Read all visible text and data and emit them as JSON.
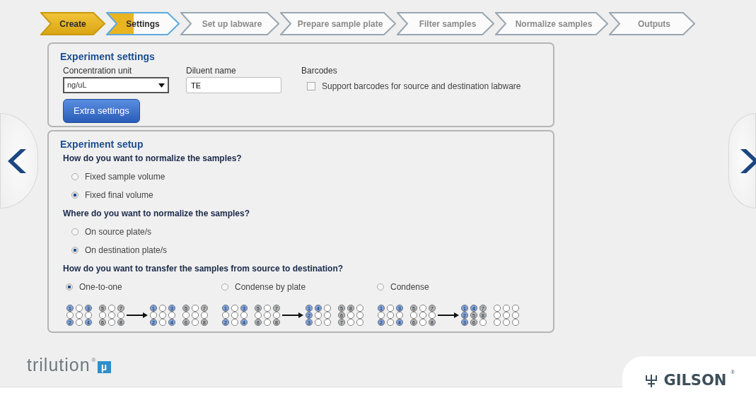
{
  "steps": [
    {
      "label": "Create",
      "completed": true,
      "selected": false
    },
    {
      "label": "Settings",
      "completed": false,
      "selected": true
    },
    {
      "label": "Set up labware",
      "completed": false,
      "selected": false
    },
    {
      "label": "Prepare sample plate",
      "completed": false,
      "selected": false
    },
    {
      "label": "Filter samples",
      "completed": false,
      "selected": false
    },
    {
      "label": "Normalize samples",
      "completed": false,
      "selected": false
    },
    {
      "label": "Outputs",
      "completed": false,
      "selected": false
    }
  ],
  "experiment_settings": {
    "title": "Experiment settings",
    "concentration_unit": {
      "label": "Concentration unit",
      "value": "ng/uL"
    },
    "diluent_name": {
      "label": "Diluent name",
      "value": "TE"
    },
    "barcodes": {
      "label": "Barcodes",
      "option": "Support barcodes for source and destination labware",
      "checked": false
    },
    "extra_button": "Extra settings"
  },
  "experiment_setup": {
    "title": "Experiment setup",
    "questions": [
      {
        "question": "How do you want to normalize the samples?",
        "kind": "stack",
        "options": [
          {
            "label": "Fixed sample volume",
            "selected": false
          },
          {
            "label": "Fixed final volume",
            "selected": true
          }
        ]
      },
      {
        "question": "Where do you want to normalize the samples?",
        "kind": "stack",
        "options": [
          {
            "label": "On source plate/s",
            "selected": false
          },
          {
            "label": "On destination plate/s",
            "selected": true
          }
        ]
      },
      {
        "question": "How do you want to transfer the samples from source to destination?",
        "kind": "columns",
        "options": [
          {
            "label": "One-to-one",
            "selected": true,
            "plates": [
              [
                {
                  "kind": "filled",
                  "n": "1",
                  "color": "#7fa2dc"
                },
                {
                  "kind": "empty"
                },
                {
                  "kind": "filled",
                  "n": "3",
                  "color": "#7fa2dc"
                },
                {
                  "kind": "empty"
                },
                {
                  "kind": "empty"
                },
                {
                  "kind": "empty"
                },
                {
                  "kind": "filled",
                  "n": "2",
                  "color": "#7fa2dc"
                },
                {
                  "kind": "empty"
                },
                {
                  "kind": "filled",
                  "n": "4",
                  "color": "#7fa2dc"
                }
              ],
              [
                {
                  "kind": "filled",
                  "n": "5",
                  "color": "#b4b4b4"
                },
                {
                  "kind": "empty"
                },
                {
                  "kind": "filled",
                  "n": "7",
                  "color": "#b4b4b4"
                },
                {
                  "kind": "empty"
                },
                {
                  "kind": "empty"
                },
                {
                  "kind": "empty"
                },
                {
                  "kind": "filled",
                  "n": "6",
                  "color": "#b4b4b4"
                },
                {
                  "kind": "empty"
                },
                {
                  "kind": "filled",
                  "n": "8",
                  "color": "#b4b4b4"
                }
              ],
              [
                {
                  "kind": "filled",
                  "n": "1",
                  "color": "#7fa2dc"
                },
                {
                  "kind": "empty"
                },
                {
                  "kind": "filled",
                  "n": "3",
                  "color": "#7fa2dc"
                },
                {
                  "kind": "empty"
                },
                {
                  "kind": "empty"
                },
                {
                  "kind": "empty"
                },
                {
                  "kind": "filled",
                  "n": "2",
                  "color": "#7fa2dc"
                },
                {
                  "kind": "empty"
                },
                {
                  "kind": "filled",
                  "n": "4",
                  "color": "#7fa2dc"
                }
              ],
              [
                {
                  "kind": "filled",
                  "n": "5",
                  "color": "#b4b4b4"
                },
                {
                  "kind": "empty"
                },
                {
                  "kind": "filled",
                  "n": "7",
                  "color": "#b4b4b4"
                },
                {
                  "kind": "empty"
                },
                {
                  "kind": "empty"
                },
                {
                  "kind": "empty"
                },
                {
                  "kind": "filled",
                  "n": "6",
                  "color": "#b4b4b4"
                },
                {
                  "kind": "empty"
                },
                {
                  "kind": "filled",
                  "n": "8",
                  "color": "#b4b4b4"
                }
              ]
            ]
          },
          {
            "label": "Condense by plate",
            "selected": false,
            "plates": [
              [
                {
                  "kind": "filled",
                  "n": "1",
                  "color": "#7fa2dc"
                },
                {
                  "kind": "empty"
                },
                {
                  "kind": "filled",
                  "n": "3",
                  "color": "#7fa2dc"
                },
                {
                  "kind": "empty"
                },
                {
                  "kind": "empty"
                },
                {
                  "kind": "empty"
                },
                {
                  "kind": "filled",
                  "n": "2",
                  "color": "#7fa2dc"
                },
                {
                  "kind": "empty"
                },
                {
                  "kind": "filled",
                  "n": "4",
                  "color": "#7fa2dc"
                }
              ],
              [
                {
                  "kind": "filled",
                  "n": "5",
                  "color": "#b4b4b4"
                },
                {
                  "kind": "empty"
                },
                {
                  "kind": "filled",
                  "n": "7",
                  "color": "#b4b4b4"
                },
                {
                  "kind": "empty"
                },
                {
                  "kind": "empty"
                },
                {
                  "kind": "empty"
                },
                {
                  "kind": "filled",
                  "n": "6",
                  "color": "#b4b4b4"
                },
                {
                  "kind": "empty"
                },
                {
                  "kind": "filled",
                  "n": "8",
                  "color": "#b4b4b4"
                }
              ],
              [
                {
                  "kind": "filled",
                  "n": "1",
                  "color": "#7fa2dc"
                },
                {
                  "kind": "filled",
                  "n": "4",
                  "color": "#7fa2dc"
                },
                {
                  "kind": "empty"
                },
                {
                  "kind": "filled",
                  "n": "2",
                  "color": "#7fa2dc"
                },
                {
                  "kind": "empty"
                },
                {
                  "kind": "empty"
                },
                {
                  "kind": "filled",
                  "n": "3",
                  "color": "#7fa2dc"
                },
                {
                  "kind": "empty"
                },
                {
                  "kind": "empty"
                }
              ],
              [
                {
                  "kind": "filled",
                  "n": "5",
                  "color": "#b4b4b4"
                },
                {
                  "kind": "filled",
                  "n": "8",
                  "color": "#b4b4b4"
                },
                {
                  "kind": "empty"
                },
                {
                  "kind": "filled",
                  "n": "6",
                  "color": "#b4b4b4"
                },
                {
                  "kind": "empty"
                },
                {
                  "kind": "empty"
                },
                {
                  "kind": "filled",
                  "n": "7",
                  "color": "#b4b4b4"
                },
                {
                  "kind": "empty"
                },
                {
                  "kind": "empty"
                }
              ]
            ]
          },
          {
            "label": "Condense",
            "selected": false,
            "plates": [
              [
                {
                  "kind": "filled",
                  "n": "1",
                  "color": "#7fa2dc"
                },
                {
                  "kind": "empty"
                },
                {
                  "kind": "filled",
                  "n": "3",
                  "color": "#7fa2dc"
                },
                {
                  "kind": "empty"
                },
                {
                  "kind": "empty"
                },
                {
                  "kind": "empty"
                },
                {
                  "kind": "filled",
                  "n": "2",
                  "color": "#7fa2dc"
                },
                {
                  "kind": "empty"
                },
                {
                  "kind": "filled",
                  "n": "4",
                  "color": "#7fa2dc"
                }
              ],
              [
                {
                  "kind": "filled",
                  "n": "5",
                  "color": "#b4b4b4"
                },
                {
                  "kind": "empty"
                },
                {
                  "kind": "filled",
                  "n": "7",
                  "color": "#b4b4b4"
                },
                {
                  "kind": "empty"
                },
                {
                  "kind": "empty"
                },
                {
                  "kind": "empty"
                },
                {
                  "kind": "filled",
                  "n": "6",
                  "color": "#b4b4b4"
                },
                {
                  "kind": "empty"
                },
                {
                  "kind": "filled",
                  "n": "8",
                  "color": "#b4b4b4"
                }
              ],
              [
                {
                  "kind": "filled",
                  "n": "1",
                  "color": "#7fa2dc"
                },
                {
                  "kind": "filled",
                  "n": "4",
                  "color": "#7fa2dc"
                },
                {
                  "kind": "filled",
                  "n": "7",
                  "color": "#b4b4b4"
                },
                {
                  "kind": "filled",
                  "n": "2",
                  "color": "#7fa2dc"
                },
                {
                  "kind": "filled",
                  "n": "5",
                  "color": "#b4b4b4"
                },
                {
                  "kind": "filled",
                  "n": "8",
                  "color": "#b4b4b4"
                },
                {
                  "kind": "filled",
                  "n": "3",
                  "color": "#7fa2dc"
                },
                {
                  "kind": "filled",
                  "n": "6",
                  "color": "#b4b4b4"
                },
                {
                  "kind": "empty"
                }
              ],
              [
                {
                  "kind": "empty"
                },
                {
                  "kind": "empty"
                },
                {
                  "kind": "empty"
                },
                {
                  "kind": "empty"
                },
                {
                  "kind": "empty"
                },
                {
                  "kind": "empty"
                },
                {
                  "kind": "empty"
                },
                {
                  "kind": "empty"
                },
                {
                  "kind": "empty"
                }
              ]
            ]
          }
        ]
      }
    ]
  },
  "footer": {
    "product": "trilution",
    "product_mark": "®",
    "product_badge": "µ",
    "company": "GILSON",
    "company_mark": "®"
  }
}
